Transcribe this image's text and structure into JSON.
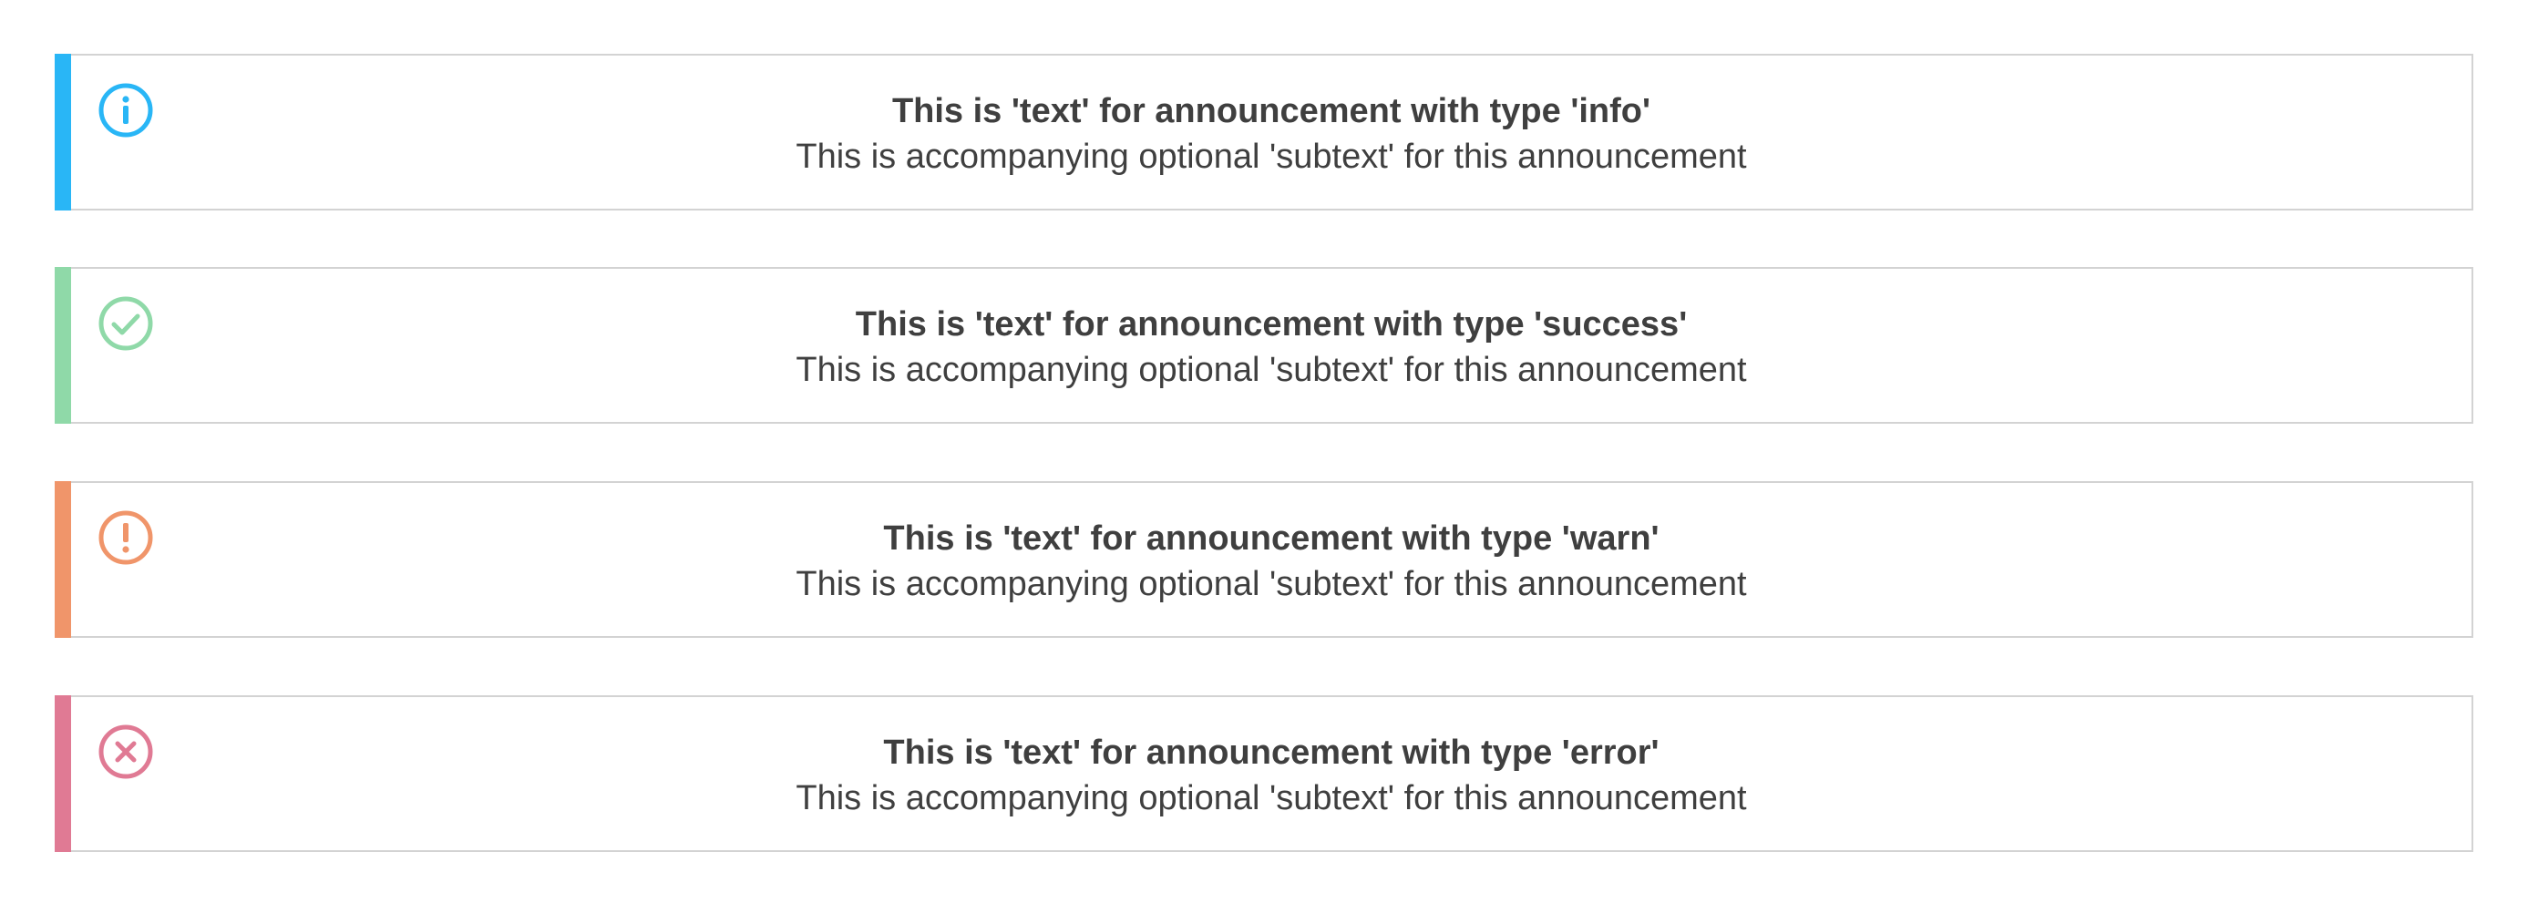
{
  "announcements": [
    {
      "type": "info",
      "text": "This is 'text' for announcement with type 'info'",
      "subtext": "This is accompanying optional 'subtext' for this announcement",
      "color": "#29b6f6",
      "icon": "info-icon"
    },
    {
      "type": "success",
      "text": "This is 'text' for announcement with type 'success'",
      "subtext": "This is accompanying optional 'subtext' for this announcement",
      "color": "#8fd9a8",
      "icon": "checkmark-circle-icon"
    },
    {
      "type": "warn",
      "text": "This is 'text' for announcement with type 'warn'",
      "subtext": "This is accompanying optional 'subtext' for this announcement",
      "color": "#f0956a",
      "icon": "exclamation-circle-icon"
    },
    {
      "type": "error",
      "text": "This is 'text' for announcement with type 'error'",
      "subtext": "This is accompanying optional 'subtext' for this announcement",
      "color": "#e07a94",
      "icon": "close-circle-icon"
    }
  ]
}
